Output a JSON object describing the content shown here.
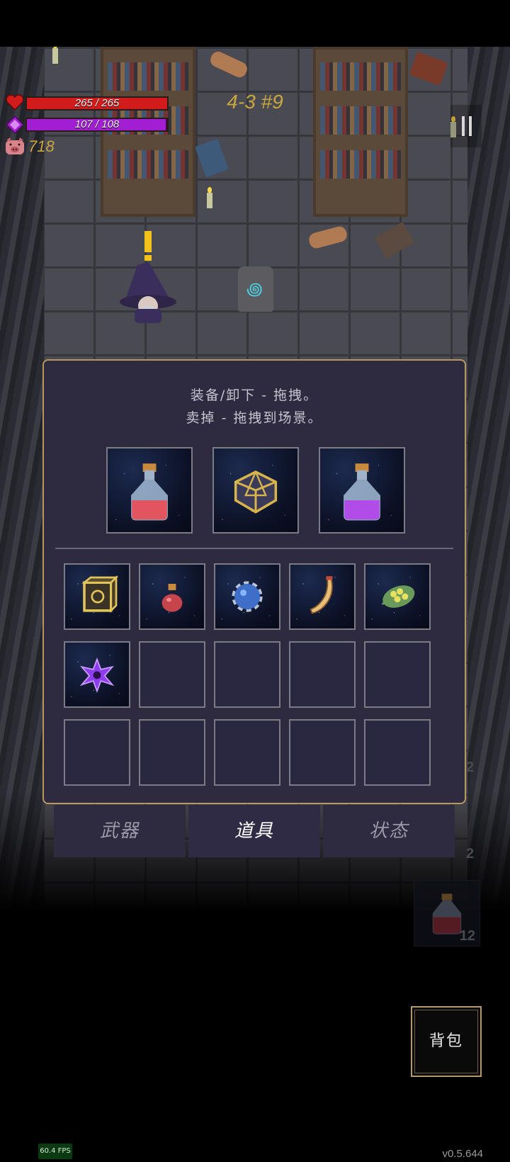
{
  "hud": {
    "hp": {
      "current": 265,
      "max": 265,
      "text": "265 / 265",
      "color": "#d21c1c"
    },
    "mp": {
      "current": 107,
      "max": 108,
      "text": "107 / 108",
      "color": "#a11fd0"
    },
    "gold": "718",
    "level": "4-3 #9",
    "pause_icon": "pause-icon"
  },
  "inventory": {
    "hint_line1": "装备/卸下 - 拖拽。",
    "hint_line2": "卖掉 - 拖拽到场景。",
    "equipped": [
      {
        "icon": "red-potion-icon"
      },
      {
        "icon": "golden-polyhedron-icon"
      },
      {
        "icon": "purple-potion-icon"
      }
    ],
    "bag": [
      {
        "icon": "rune-cube-icon"
      },
      {
        "icon": "small-red-flask-icon"
      },
      {
        "icon": "blue-orb-cage-icon"
      },
      {
        "icon": "horn-icon"
      },
      {
        "icon": "seed-leaf-icon"
      },
      {
        "icon": "purple-shuriken-icon"
      },
      {
        "icon": null
      },
      {
        "icon": null
      },
      {
        "icon": null
      },
      {
        "icon": null
      },
      {
        "icon": null
      },
      {
        "icon": null
      },
      {
        "icon": null
      },
      {
        "icon": null
      },
      {
        "icon": null
      }
    ]
  },
  "tabs": [
    {
      "label": "武器",
      "active": false
    },
    {
      "label": "道具",
      "active": true
    },
    {
      "label": "状态",
      "active": false
    }
  ],
  "side_counts": [
    "2",
    "2"
  ],
  "quick_slot": {
    "count": "12",
    "icon": "red-potion-icon"
  },
  "backpack_label": "背包",
  "fps": "60.4 FPS",
  "version": "v0.5.644"
}
